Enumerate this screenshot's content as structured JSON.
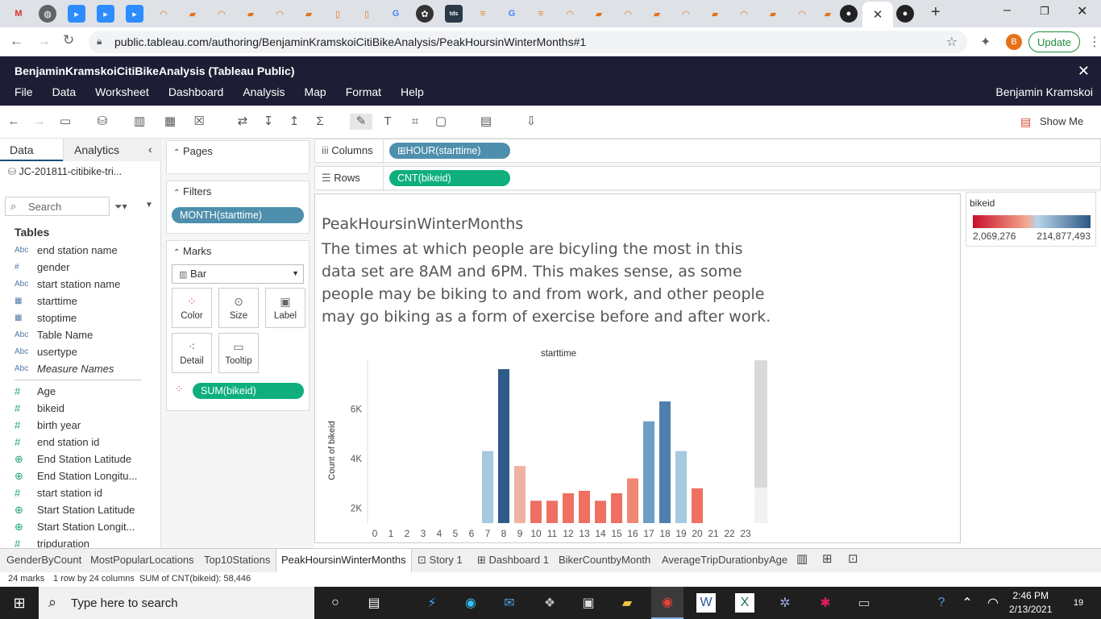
{
  "browser": {
    "url": "public.tableau.com/authoring/BenjaminKramskoiCitiBikeAnalysis/PeakHoursinWinterMonths#1",
    "update_label": "Update",
    "profile_initial": "B",
    "tab_close": "✕"
  },
  "app": {
    "title": "BenjaminKramskoiCitiBikeAnalysis (Tableau Public)",
    "menus": [
      "File",
      "Data",
      "Worksheet",
      "Dashboard",
      "Analysis",
      "Map",
      "Format",
      "Help"
    ],
    "user": "Benjamin Kramskoi",
    "show_me": "Show Me"
  },
  "data_pane": {
    "tab_data": "Data",
    "tab_analytics": "Analytics",
    "datasource": "JC-201811-citibike-tri...",
    "search_placeholder": "Search",
    "tables_title": "Tables",
    "dimensions": [
      {
        "type": "Abc",
        "name": "end station name"
      },
      {
        "type": "#",
        "name": "gender"
      },
      {
        "type": "Abc",
        "name": "start station name"
      },
      {
        "type": "date",
        "name": "starttime"
      },
      {
        "type": "date",
        "name": "stoptime"
      },
      {
        "type": "Abc",
        "name": "Table Name"
      },
      {
        "type": "Abc",
        "name": "usertype"
      },
      {
        "type": "Abc",
        "name": "Measure Names"
      }
    ],
    "measures": [
      {
        "type": "#",
        "name": "Age"
      },
      {
        "type": "#",
        "name": "bikeid"
      },
      {
        "type": "#",
        "name": "birth year"
      },
      {
        "type": "#",
        "name": "end station id"
      },
      {
        "type": "geo",
        "name": "End Station Latitude"
      },
      {
        "type": "geo",
        "name": "End Station Longitu..."
      },
      {
        "type": "#",
        "name": "start station id"
      },
      {
        "type": "geo",
        "name": "Start Station Latitude"
      },
      {
        "type": "geo",
        "name": "Start Station Longit..."
      },
      {
        "type": "#",
        "name": "tripduration"
      }
    ]
  },
  "shelves": {
    "pages_title": "Pages",
    "filters_title": "Filters",
    "filter_pill": "MONTH(starttime)",
    "marks_title": "Marks",
    "mark_type": "Bar",
    "mark_buttons": [
      "Color",
      "Size",
      "Label",
      "Detail",
      "Tooltip"
    ],
    "color_pill": "SUM(bikeid)",
    "columns_label": "Columns",
    "columns_pill": "HOUR(starttime)",
    "rows_label": "Rows",
    "rows_pill": "CNT(bikeid)"
  },
  "viz": {
    "title": "PeakHoursinWinterMonths",
    "description": "The times at which people are bicyling the most in this data set are 8AM and 6PM. This makes sense, as some people may be biking to and from work, and other people may go biking as a form of exercise before and after work."
  },
  "legend": {
    "title": "bikeid",
    "min_label": "2,069,276",
    "max_label": "214,877,493"
  },
  "chart_data": {
    "type": "bar",
    "title": "starttime",
    "xlabel": "",
    "ylabel": "Count of bikeid",
    "categories": [
      "0",
      "1",
      "2",
      "3",
      "4",
      "5",
      "6",
      "7",
      "8",
      "9",
      "10",
      "11",
      "12",
      "13",
      "14",
      "15",
      "16",
      "17",
      "18",
      "19",
      "20",
      "21",
      "22",
      "23"
    ],
    "values": [
      0,
      0,
      0,
      0,
      0,
      0,
      1300,
      4300,
      7600,
      3700,
      2300,
      2300,
      2600,
      2700,
      2300,
      2600,
      3200,
      5500,
      6300,
      4300,
      2800,
      0,
      0,
      0
    ],
    "colors": [
      "#ffffff",
      "#ffffff",
      "#ffffff",
      "#ffffff",
      "#ffffff",
      "#ffffff",
      "#e0503e",
      "#a6c8e0",
      "#2e5b8a",
      "#f0b2a2",
      "#ee7060",
      "#ee7060",
      "#ee7060",
      "#ee7060",
      "#ee7060",
      "#ee7060",
      "#f08770",
      "#6f9ec4",
      "#4f7fae",
      "#a6c8e0",
      "#ee7060",
      "#ffffff",
      "#ffffff",
      "#ffffff"
    ],
    "yticks": [
      "2K",
      "4K",
      "6K"
    ],
    "ytick_values": [
      2000,
      4000,
      6000
    ],
    "ylim": [
      1400,
      7600
    ],
    "grid": false
  },
  "sheets": [
    "GenderByCount",
    "MostPopularLocations",
    "Top10Stations",
    "PeakHoursinWinterMonths",
    "Story 1",
    "Dashboard 1",
    "BikerCountbyMonth",
    "AverageTripDurationbyAge"
  ],
  "status": {
    "marks": "24 marks",
    "dims": "1 row by 24 columns",
    "sum": "SUM of CNT(bikeid): 58,446"
  },
  "taskbar": {
    "search_placeholder": "Type here to search",
    "time": "2:46 PM",
    "date": "2/13/2021",
    "notifications": "19"
  }
}
